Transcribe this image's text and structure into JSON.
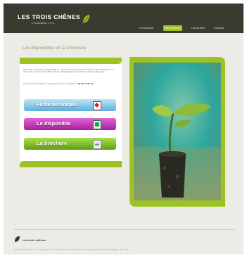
{
  "header": {
    "brand_title": "LES TROIS CHÊNES",
    "brand_subtitle_prefix": "L'innovation ",
    "brand_subtitle_accent": "verte",
    "nav": [
      {
        "label": "L'entreprise",
        "active": false
      },
      {
        "label": "Nos produits",
        "active": true
      },
      {
        "label": "Les jardins",
        "active": false
      },
      {
        "label": "Contact",
        "active": false
      }
    ]
  },
  "main": {
    "title": "Les disponibles et la brochure",
    "intro": "Retrouvez ci-dessous la disponibilité de nos produits ainsi que la brochure de notre entreprise. Les documents sont au format PDF et Excel, téléchargeables directement depuis cette page.",
    "contact_prefix": "Pour plus d'informations, n'hésitez pas à nous contacter au",
    "contact_phone": "03 85 76 03 42",
    "buttons": [
      {
        "label": "Fiche technique",
        "icon": "pdf-icon"
      },
      {
        "label": "Le disponible",
        "icon": "excel-icon"
      },
      {
        "label": "La brochure",
        "icon": "document-icon"
      }
    ]
  },
  "footer": {
    "name": "Les trois chênes",
    "text": "Les Trois Chênes – Pépinière – 71 000 Mâcon – Tél. 03 85 76 03 42 – Fax 03 85 76 03 43 – contact@lestroischenes.fr – Mentions légales – Plan du site"
  },
  "colors": {
    "header_bg": "#3a3a31",
    "accent_green": "#9cc321",
    "button_blue": "#5eb0d8",
    "button_magenta": "#a8209e",
    "button_green": "#5d9c14"
  }
}
